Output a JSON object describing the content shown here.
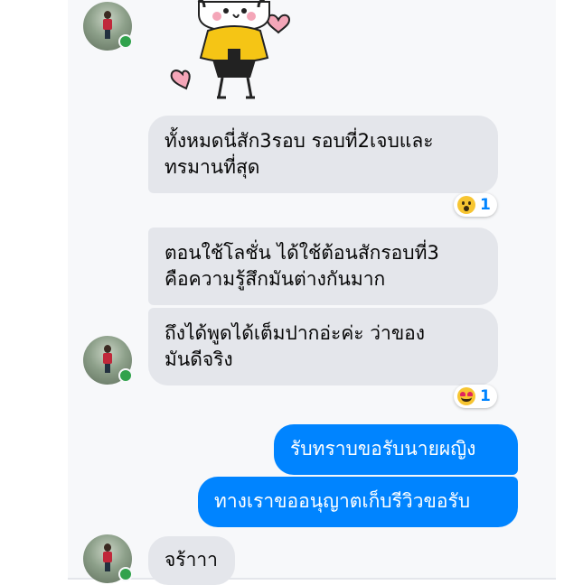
{
  "conversation": {
    "messages": [
      {
        "id": "m1",
        "text": "ทั้งหมดนี่สัก3รอบ รอบที่2เจบและ\nทรมานที่สุด",
        "reaction": {
          "icon": "surprised-face-icon",
          "count": "1"
        }
      },
      {
        "id": "m2",
        "text": "ตอนใช้โลชั่น ได้ใช้ต้อนสักรอบที่3\nคือความรู้สึกมันต่างกันมาก"
      },
      {
        "id": "m3",
        "text": "ถึงได้พูดได้เต็มปากอ่ะค่ะ ว่าของ\nมันดีจริง",
        "reaction": {
          "icon": "heart-eyes-face-icon",
          "count": "1"
        }
      },
      {
        "id": "m4",
        "text": "รับทราบขอรับนายผญิง"
      },
      {
        "id": "m5",
        "text": "ทางเราขออนุญาตเก็บรีวิวขอรับ"
      },
      {
        "id": "m6",
        "text": "จร้าาา"
      }
    ]
  },
  "colors": {
    "incoming_bubble": "#e4e6eb",
    "outgoing_bubble": "#0084ff",
    "online_indicator": "#31a24c",
    "reaction_count": "#0084ff"
  }
}
